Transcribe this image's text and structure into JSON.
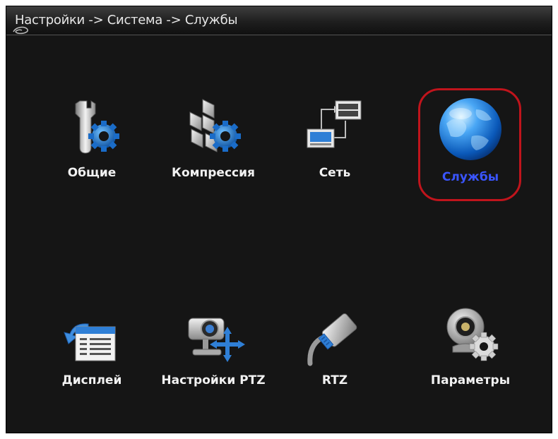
{
  "header": {
    "breadcrumb": "Настройки -> Система -> Службы"
  },
  "menu": {
    "selected": "services",
    "items": [
      {
        "id": "general",
        "label": "Общие",
        "icon": "wrench-gear-icon"
      },
      {
        "id": "compression",
        "label": "Компрессия",
        "icon": "blocks-gear-icon"
      },
      {
        "id": "network",
        "label": "Сеть",
        "icon": "network-computers-icon"
      },
      {
        "id": "services",
        "label": "Службы",
        "icon": "globe-icon"
      },
      {
        "id": "display",
        "label": "Дисплей",
        "icon": "display-window-icon"
      },
      {
        "id": "ptz-settings",
        "label": "Настройки PTZ",
        "icon": "ptz-camera-icon"
      },
      {
        "id": "rtz",
        "label": "RTZ",
        "icon": "cable-connector-icon"
      },
      {
        "id": "parameters",
        "label": "Параметры",
        "icon": "webcam-gear-icon"
      }
    ]
  },
  "colors": {
    "selected_label": "#3a55ff",
    "selection_ring": "#c0141c",
    "background": "#151515"
  }
}
